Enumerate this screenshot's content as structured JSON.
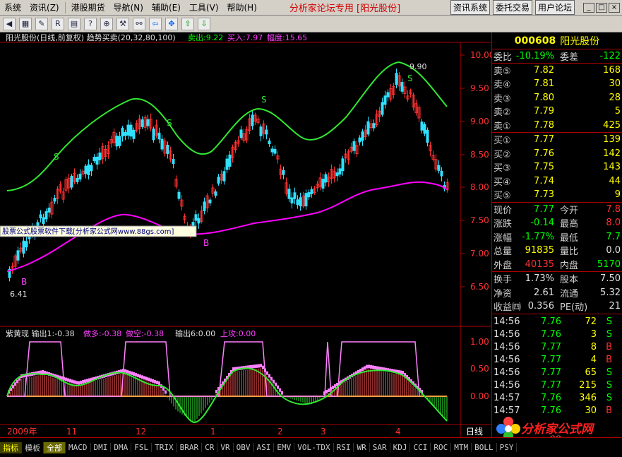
{
  "menu": {
    "items": [
      "系统",
      "资讯(Z)",
      "港股期货",
      "导航(N)",
      "辅助(E)",
      "工具(V)",
      "帮助(H)"
    ],
    "brand": "分析家论坛专用 [阳光股份]",
    "buttons": [
      "资讯系统",
      "委托交易",
      "用户论坛"
    ],
    "window_controls": [
      "_",
      "□",
      "×"
    ]
  },
  "chart": {
    "header": "阳光股份(日线,前复权) 趋势买卖(20,32,80,100)",
    "sell_label": "卖出:9.22",
    "buy_label": "买入:7.97",
    "range_label": "幅度:15.65",
    "price_axis": [
      "10.00",
      "9.50",
      "9.00",
      "8.50",
      "8.00",
      "7.50",
      "7.00",
      "6.50"
    ],
    "annotations": {
      "high": "9.90",
      "low": "6.41",
      "s1": "S",
      "s2": "S",
      "s3": "S",
      "s4": "S",
      "b1": "B",
      "b2": "B"
    },
    "ad_banner": "股票公式股票软件下载[分析家公式网www.88gs.com]",
    "indicator_header": "紫黄现 输出1:-0.38",
    "indicator_more": "做多:-0.38",
    "indicator_short": "做空:-0.38",
    "indicator_out6": "输出6:0.00",
    "indicator_up": "上攻:0.00",
    "ind_axis": [
      "1.00",
      "0.50",
      "0.00"
    ],
    "x_labels": [
      "2009年",
      "11",
      "12",
      "1",
      "2",
      "3",
      "4"
    ],
    "period": "日线",
    "colors": {
      "green_line": "#30e830",
      "magenta_line": "#ff00ff",
      "candle_up": "#ff3030",
      "candle_down": "#30e0ff"
    }
  },
  "quote": {
    "code": "000608",
    "name": "阳光股份",
    "weibi_label": "委比",
    "weibi_value": "-10.19%",
    "weicha_label": "委差",
    "weicha_value": "-122",
    "sell": [
      {
        "label": "卖⑤",
        "price": "7.82",
        "vol": "168"
      },
      {
        "label": "卖④",
        "price": "7.81",
        "vol": "30"
      },
      {
        "label": "卖③",
        "price": "7.80",
        "vol": "28"
      },
      {
        "label": "卖②",
        "price": "7.79",
        "vol": "5"
      },
      {
        "label": "卖①",
        "price": "7.78",
        "vol": "425"
      }
    ],
    "buy": [
      {
        "label": "买①",
        "price": "7.77",
        "vol": "139"
      },
      {
        "label": "买②",
        "price": "7.76",
        "vol": "142"
      },
      {
        "label": "买③",
        "price": "7.75",
        "vol": "143"
      },
      {
        "label": "买④",
        "price": "7.74",
        "vol": "44"
      },
      {
        "label": "买⑤",
        "price": "7.73",
        "vol": "9"
      }
    ],
    "stats": [
      {
        "l1": "现价",
        "v1": "7.77",
        "c1": "grn",
        "l2": "今开",
        "v2": "7.8",
        "c2": "red"
      },
      {
        "l1": "涨跌",
        "v1": "-0.14",
        "c1": "grn",
        "l2": "最高",
        "v2": "8.0",
        "c2": "red"
      },
      {
        "l1": "涨幅",
        "v1": "-1.77%",
        "c1": "grn",
        "l2": "最低",
        "v2": "7.7",
        "c2": "grn"
      },
      {
        "l1": "总量",
        "v1": "91835",
        "c1": "yel",
        "l2": "量比",
        "v2": "0.0",
        "c2": "wht"
      },
      {
        "l1": "外盘",
        "v1": "40135",
        "c1": "red",
        "l2": "内盘",
        "v2": "5170",
        "c2": "grn"
      }
    ],
    "fin": [
      {
        "l1": "换手",
        "v1": "1.73%",
        "l2": "股本",
        "v2": "7.50"
      },
      {
        "l1": "净资",
        "v1": "2.61",
        "l2": "流通",
        "v2": "5.32"
      },
      {
        "l1": "收益㈣",
        "v1": "0.356",
        "l2": "PE(动)",
        "v2": "21"
      }
    ],
    "ticks": [
      {
        "time": "14:56",
        "price": "7.76",
        "vol": "72",
        "bs": "S"
      },
      {
        "time": "14:56",
        "price": "7.76",
        "vol": "3",
        "bs": "S"
      },
      {
        "time": "14:56",
        "price": "7.77",
        "vol": "8",
        "bs": "B"
      },
      {
        "time": "14:56",
        "price": "7.77",
        "vol": "4",
        "bs": "B"
      },
      {
        "time": "14:56",
        "price": "7.77",
        "vol": "65",
        "bs": "S"
      },
      {
        "time": "14:56",
        "price": "7.77",
        "vol": "215",
        "bs": "S"
      },
      {
        "time": "14:57",
        "price": "7.76",
        "vol": "346",
        "bs": "S"
      },
      {
        "time": "14:57",
        "price": "7.76",
        "vol": "30",
        "bs": "B"
      }
    ]
  },
  "tabs": [
    "指标",
    "模板",
    "全部",
    "MACD",
    "DMI",
    "DMA",
    "FSL",
    "TRIX",
    "BRAR",
    "CR",
    "VR",
    "OBV",
    "ASI",
    "EMV",
    "VOL-TDX",
    "RSI",
    "WR",
    "SAR",
    "KDJ",
    "CCI",
    "ROC",
    "MTM",
    "BOLL",
    "PSY"
  ],
  "watermark": {
    "title": "分析家公式网",
    "url": "www.88gs.com"
  }
}
